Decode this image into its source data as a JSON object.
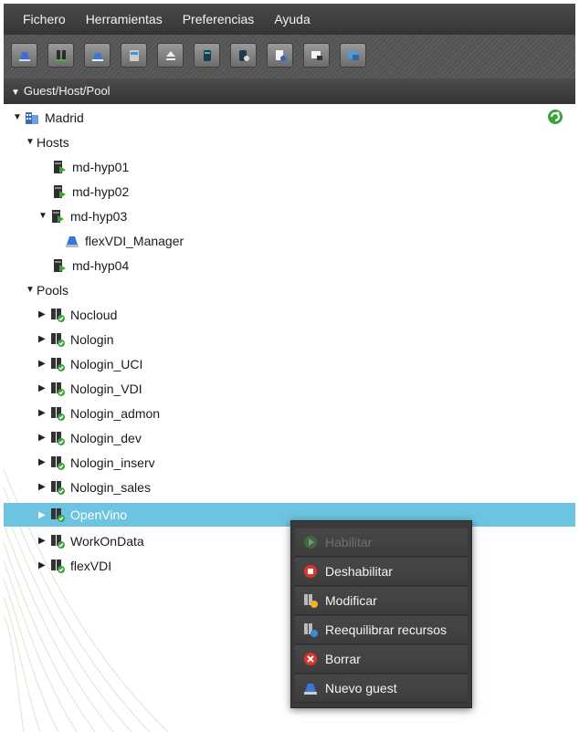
{
  "menubar": [
    "Fichero",
    "Herramientas",
    "Preferencias",
    "Ayuda"
  ],
  "toolbar_icons": [
    "new-guest-icon",
    "new-pool-icon",
    "guest-icon",
    "storage-icon",
    "eject-icon",
    "database-icon",
    "database-config-icon",
    "document-user-icon",
    "terminal-icon",
    "monitor-icon"
  ],
  "panel": {
    "title": "Guest/Host/Pool"
  },
  "tree": {
    "root": "Madrid",
    "hosts_label": "Hosts",
    "hosts": [
      "md-hyp01",
      "md-hyp02",
      "md-hyp03",
      "md-hyp04"
    ],
    "guest": "flexVDI_Manager",
    "pools_label": "Pools",
    "pools": [
      "Nocloud",
      "Nologin",
      "Nologin_UCI",
      "Nologin_VDI",
      "Nologin_admon",
      "Nologin_dev",
      "Nologin_inserv",
      "Nologin_sales",
      "OpenVino",
      "WorkOnData",
      "flexVDI"
    ],
    "selected": "OpenVino"
  },
  "context_menu": [
    {
      "label": "Habilitar",
      "enabled": false,
      "icon": "play-icon"
    },
    {
      "label": "Deshabilitar",
      "enabled": true,
      "icon": "stop-icon"
    },
    {
      "label": "Modificar",
      "enabled": true,
      "icon": "edit-pool-icon"
    },
    {
      "label": "Reequilibrar recursos",
      "enabled": true,
      "icon": "rebalance-icon"
    },
    {
      "label": "Borrar",
      "enabled": true,
      "icon": "delete-icon"
    },
    {
      "label": "Nuevo guest",
      "enabled": true,
      "icon": "new-guest-icon"
    }
  ],
  "colors": {
    "selection": "#6cc4e0",
    "menubar": "#3d3d3d",
    "host_green": "#3a9a2f"
  }
}
